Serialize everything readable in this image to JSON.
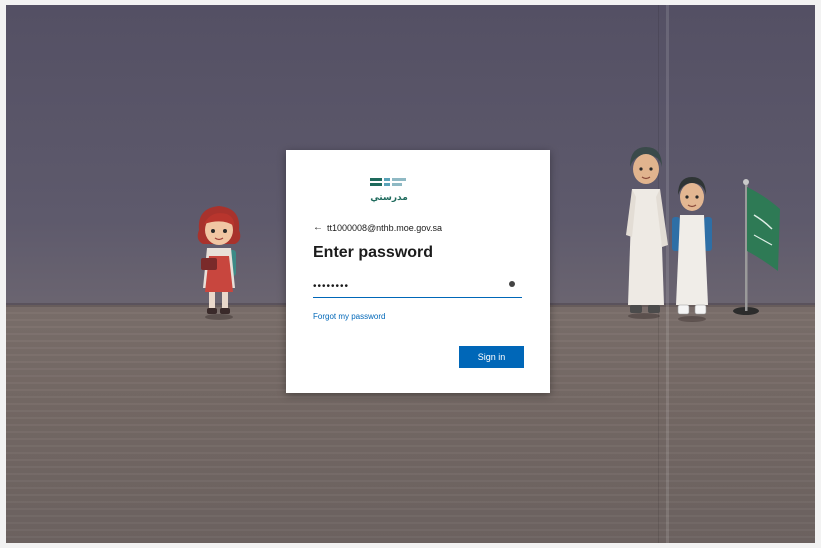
{
  "signin": {
    "logo_text": "مدرستي",
    "identity": "tt1000008@nthb.moe.gov.sa",
    "title": "Enter password",
    "password_value": "••••••••",
    "forgot_link": "Forgot my password",
    "submit_label": "Sign in"
  },
  "colors": {
    "accent": "#0067b8",
    "brand_green": "#1e6a5c"
  },
  "icons": {
    "back": "back-arrow-icon",
    "reveal": "reveal-password-icon"
  }
}
